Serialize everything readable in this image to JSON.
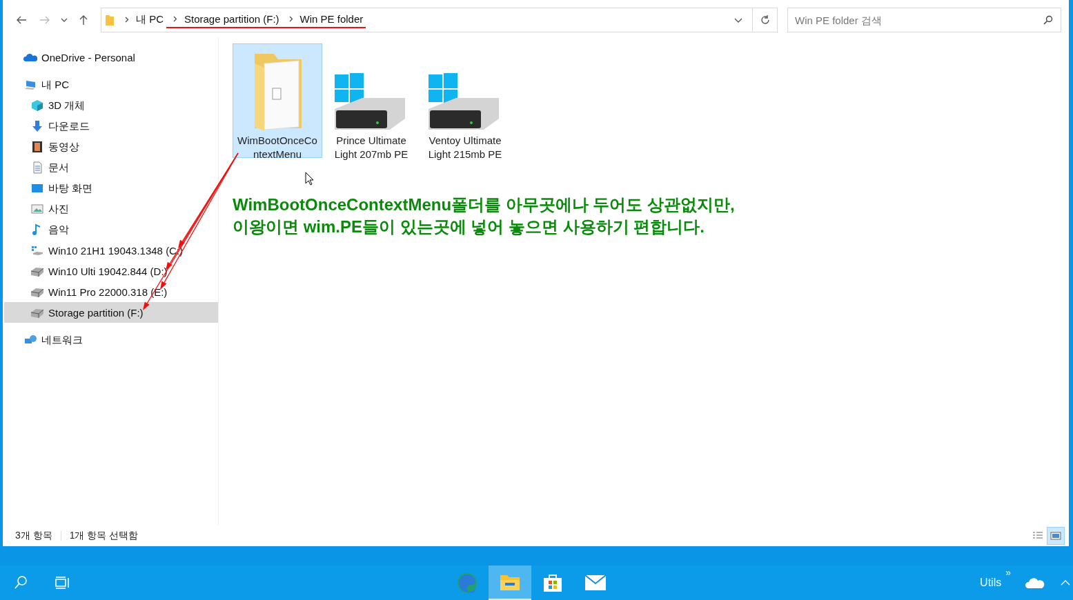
{
  "address_bar": {
    "breadcrumbs": [
      {
        "label": "내 PC",
        "underlined": false
      },
      {
        "label": "Storage partition (F:)",
        "underlined": true
      },
      {
        "label": "Win PE folder",
        "underlined": true
      }
    ]
  },
  "search": {
    "placeholder": "Win PE folder 검색"
  },
  "sidebar": {
    "items": [
      {
        "label": "OneDrive - Personal",
        "kind": "cloud",
        "selected": false
      },
      {
        "label": "내 PC",
        "kind": "pc",
        "selected": false,
        "children": [
          {
            "label": "3D 개체",
            "kind": "cube",
            "selected": false
          },
          {
            "label": "다운로드",
            "kind": "download",
            "selected": false
          },
          {
            "label": "동영상",
            "kind": "video",
            "selected": false
          },
          {
            "label": "문서",
            "kind": "document",
            "selected": false
          },
          {
            "label": "바탕 화면",
            "kind": "desktop",
            "selected": false
          },
          {
            "label": "사진",
            "kind": "pictures",
            "selected": false
          },
          {
            "label": "음악",
            "kind": "music",
            "selected": false
          },
          {
            "label": "Win10 21H1 19043.1348 (C:)",
            "kind": "windrive",
            "selected": false
          },
          {
            "label": "Win10 Ulti 19042.844 (D:)",
            "kind": "drive",
            "selected": false
          },
          {
            "label": "Win11 Pro 22000.318 (E:)",
            "kind": "drive",
            "selected": false
          },
          {
            "label": "Storage partition (F:)",
            "kind": "drive",
            "selected": true
          }
        ]
      },
      {
        "label": "네트워크",
        "kind": "network",
        "selected": false
      }
    ]
  },
  "files": [
    {
      "name": "WimBootOnceContextMenu",
      "kind": "folder",
      "selected": true
    },
    {
      "name": "Prince Ultimate Light 207mb PE",
      "kind": "windrive",
      "selected": false
    },
    {
      "name": "Ventoy Ultimate Light 215mb PE",
      "kind": "windrive",
      "selected": false
    }
  ],
  "annotation": [
    "WimBootOnceContextMenu폴더를 아무곳에나 두어도 상관없지만,",
    "이왕이면 wim.PE들이 있는곳에 넣어 놓으면 사용하기 편합니다."
  ],
  "status_bar": {
    "item_count": "3개 항목",
    "selection": "1개 항목 선택함",
    "views": [
      {
        "kind": "details",
        "selected": false
      },
      {
        "kind": "large",
        "selected": true
      }
    ]
  },
  "taskbar": {
    "apps": [
      {
        "kind": "edge",
        "selected": false
      },
      {
        "kind": "explorer",
        "selected": true
      },
      {
        "kind": "store",
        "selected": false
      },
      {
        "kind": "mail",
        "selected": false
      }
    ],
    "tray_label": "Utils",
    "tray_more": "»"
  }
}
